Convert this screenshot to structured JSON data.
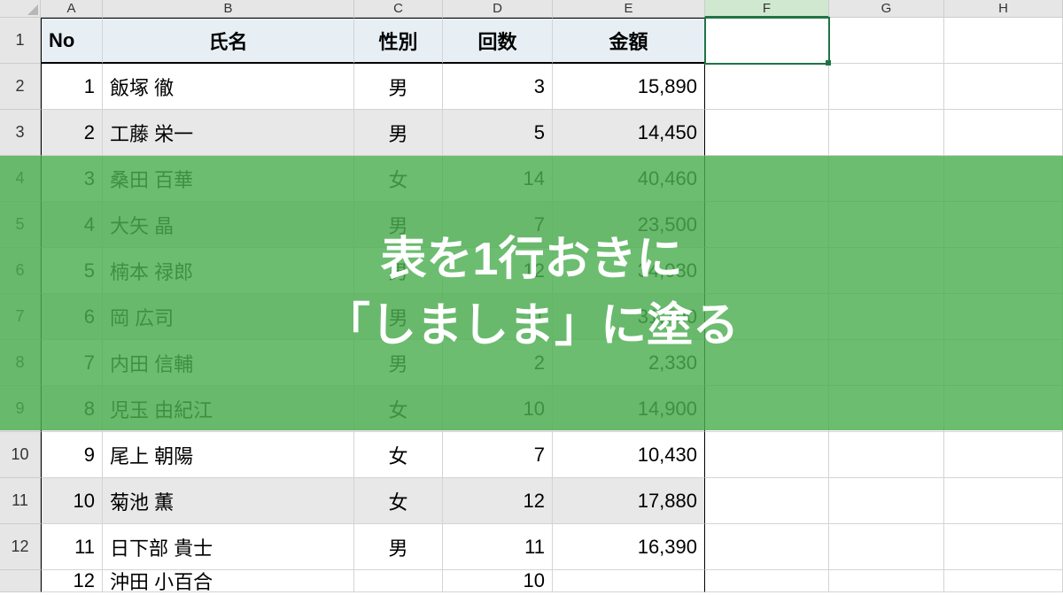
{
  "columns": [
    "A",
    "B",
    "C",
    "D",
    "E",
    "F",
    "G",
    "H"
  ],
  "rowNumbers": [
    "1",
    "2",
    "3",
    "4",
    "5",
    "6",
    "7",
    "8",
    "9",
    "10",
    "11",
    "12"
  ],
  "headers": {
    "no": "No",
    "name": "氏名",
    "gender": "性別",
    "count": "回数",
    "amount": "金額"
  },
  "rows": [
    {
      "no": "1",
      "name": "飯塚 徹",
      "gender": "男",
      "count": "3",
      "amount": "15,890",
      "stripe": false
    },
    {
      "no": "2",
      "name": "工藤 栄一",
      "gender": "男",
      "count": "5",
      "amount": "14,450",
      "stripe": true
    },
    {
      "no": "3",
      "name": "桑田 百華",
      "gender": "女",
      "count": "14",
      "amount": "40,460",
      "stripe": false
    },
    {
      "no": "4",
      "name": "大矢 晶",
      "gender": "男",
      "count": "7",
      "amount": "23,500",
      "stripe": true
    },
    {
      "no": "5",
      "name": "楠本 禄郎",
      "gender": "男",
      "count": "12",
      "amount": "34,030",
      "stripe": false
    },
    {
      "no": "6",
      "name": "岡 広司",
      "gender": "男",
      "count": "11",
      "amount": "31,790",
      "stripe": true
    },
    {
      "no": "7",
      "name": "内田 信輔",
      "gender": "男",
      "count": "2",
      "amount": "2,330",
      "stripe": false
    },
    {
      "no": "8",
      "name": "児玉 由紀江",
      "gender": "女",
      "count": "10",
      "amount": "14,900",
      "stripe": true
    },
    {
      "no": "9",
      "name": "尾上 朝陽",
      "gender": "女",
      "count": "7",
      "amount": "10,430",
      "stripe": false
    },
    {
      "no": "10",
      "name": "菊池 薫",
      "gender": "女",
      "count": "12",
      "amount": "17,880",
      "stripe": true
    },
    {
      "no": "11",
      "name": "日下部 貴士",
      "gender": "男",
      "count": "11",
      "amount": "16,390",
      "stripe": false
    }
  ],
  "partial": {
    "no": "12",
    "name": "沖田 小百合",
    "count": "10"
  },
  "overlay": {
    "line1": "表を1行おきに",
    "line2": "「しましま」に塗る"
  },
  "activeCol": "F"
}
